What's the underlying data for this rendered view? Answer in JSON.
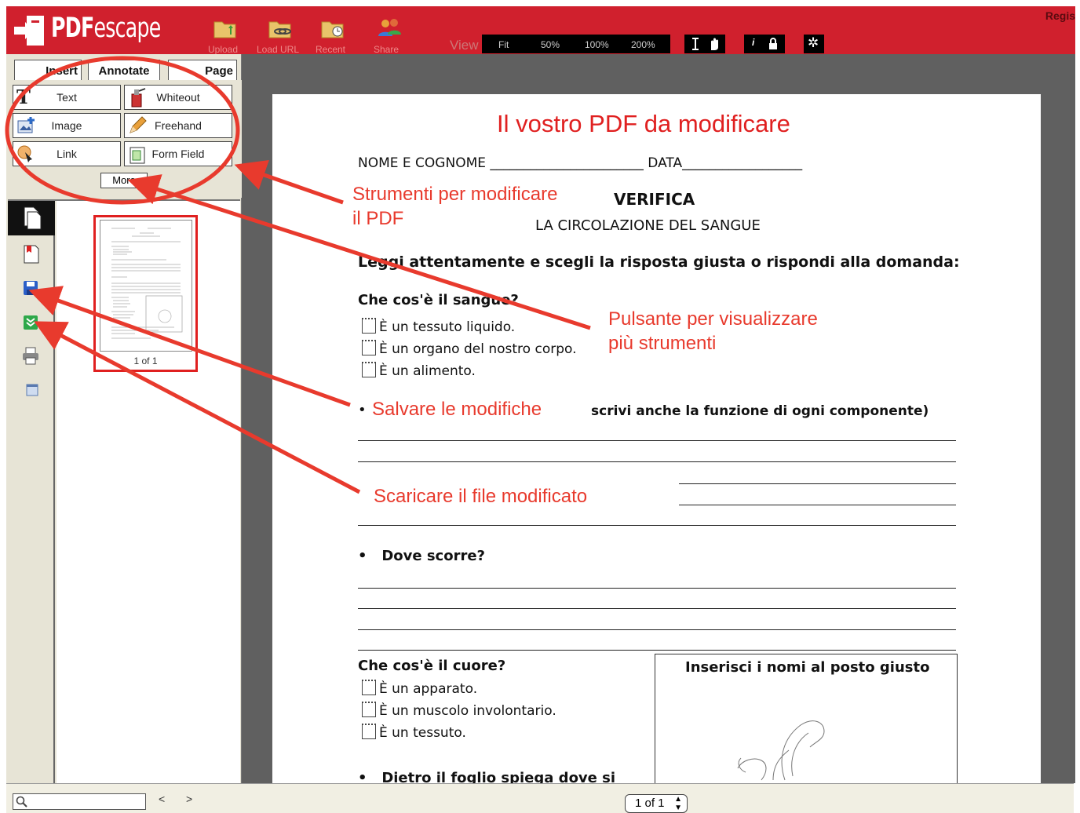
{
  "header": {
    "logo": "PDFescape",
    "logo_bold": "PDF",
    "logo_light": "escape",
    "register": "Regis",
    "buttons": [
      {
        "label": "Upload",
        "icon": "upload-folder-icon"
      },
      {
        "label": "Load URL",
        "icon": "load-url-folder-icon"
      },
      {
        "label": "Recent",
        "icon": "recent-folder-icon"
      },
      {
        "label": "Share",
        "icon": "share-users-icon"
      }
    ],
    "view_label": "View",
    "zoom_options": [
      "Fit",
      "50%",
      "100%",
      "200%"
    ]
  },
  "tabs": [
    "Insert",
    "Annotate",
    "Page"
  ],
  "tools": {
    "text": "Text",
    "whiteout": "Whiteout",
    "image": "Image",
    "freehand": "Freehand",
    "link": "Link",
    "form_field": "Form Field",
    "more": "More"
  },
  "thumbnail": {
    "label": "1 of 1"
  },
  "document": {
    "title": "Il vostro PDF da modificare",
    "name_line": "NOME E COGNOME _______________________ DATA__________________",
    "verifica": "VERIFICA",
    "subtitle": "LA CIRCOLAZIONE DEL SANGUE",
    "instructions": "Leggi attentamente e scegli la risposta giusta o rispondi alla domanda:",
    "q1": "Che cos'è il sangue?",
    "q1_options": [
      "È un tessuto liquido.",
      "È un organo del nostro corpo.",
      "È un alimento."
    ],
    "q2_tail": "scrivi anche la funzione di ogni componente)",
    "q3": "Dove scorre?",
    "q4": "Che cos'è il cuore?",
    "q4_options": [
      "È un apparato.",
      "È un muscolo involontario.",
      "È un tessuto."
    ],
    "box_title": "Inserisci i nomi al posto giusto",
    "q5": "Dietro il foglio spiega dove si"
  },
  "annotations": {
    "a1_line1": "Strumenti per modificare",
    "a1_line2": "il PDF",
    "a2_line1": "Pulsante per visualizzare",
    "a2_line2": "più strumenti",
    "a3": "Salvare le modifiche",
    "a4": "Scaricare il file modificato"
  },
  "bottombar": {
    "search_placeholder": "",
    "prev": "<",
    "next": ">",
    "page_select": "1 of 1"
  },
  "colors": {
    "brand": "#d0202d",
    "annotation": "#e83a2d"
  }
}
